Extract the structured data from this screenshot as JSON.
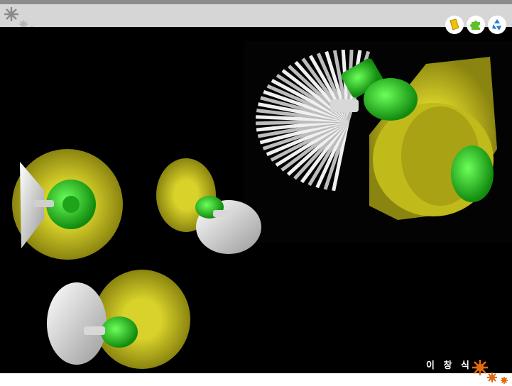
{
  "header": {
    "toolbar_icons": [
      {
        "name": "book-icon",
        "color": "#f2c200"
      },
      {
        "name": "puzzle-icon",
        "color": "#5ec12a"
      },
      {
        "name": "recycle-icon",
        "color": "#1f7ed6"
      }
    ]
  },
  "scene": {
    "subject": "bevel-gear-assembly-renders",
    "colors": {
      "ring_gear": "#c8c21a",
      "pinion_gear": "#e4e4e4",
      "hub": "#22c71e",
      "background": "#000000"
    }
  },
  "footer": {
    "author_signature": "이 창 식"
  }
}
